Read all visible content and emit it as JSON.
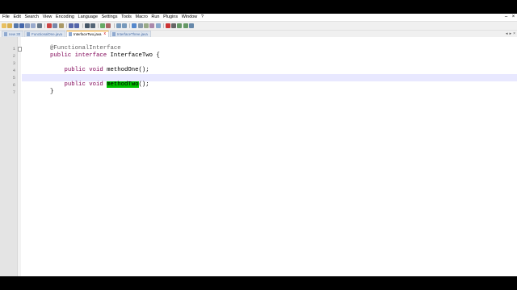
{
  "menu": [
    "File",
    "Edit",
    "Search",
    "View",
    "Encoding",
    "Language",
    "Settings",
    "Tools",
    "Macro",
    "Run",
    "Plugins",
    "Window",
    "?"
  ],
  "window_controls": {
    "minimize": "–",
    "close": "×"
  },
  "tabs": [
    {
      "label": "new 30",
      "active": false
    },
    {
      "label": "FunctionalOne.java",
      "active": false
    },
    {
      "label": "InterfaceTwo.java",
      "active": true
    },
    {
      "label": "InterfaceThree.java",
      "active": false
    }
  ],
  "tab_close": "x",
  "tab_arrows": [
    "◂",
    "▸",
    "×"
  ],
  "code_lines": [
    {
      "n": "1",
      "text": "@FunctionalInterface"
    },
    {
      "n": "2",
      "kw": "public interface",
      "rest": " InterfaceTwo {"
    },
    {
      "n": "3",
      "text": ""
    },
    {
      "n": "4",
      "indent": "    ",
      "kw": "public void",
      "rest": " methodOne();"
    },
    {
      "n": "5",
      "text": ""
    },
    {
      "n": "6",
      "indent": "    ",
      "kw": "public void",
      "pre": " ",
      "sel": "methodTwo",
      "rest": "();"
    },
    {
      "n": "7",
      "text": "}"
    }
  ]
}
